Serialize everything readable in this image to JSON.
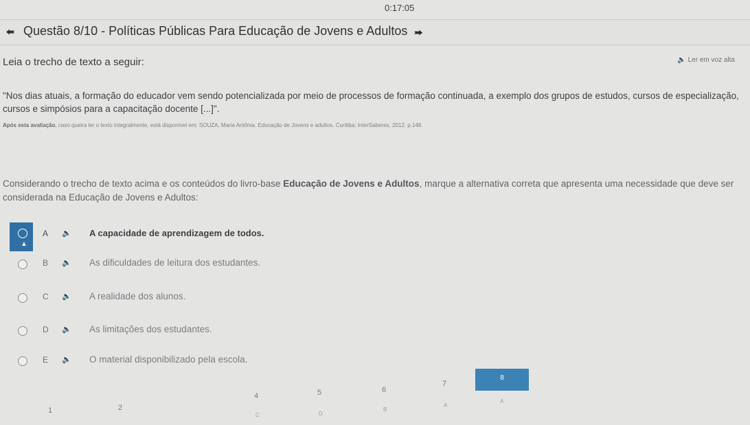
{
  "timer": "0:17:05",
  "header": {
    "prev_icon": "arrow-left-icon",
    "title": "Questão 8/10 - Políticas Públicas Para Educação de Jovens e Adultos",
    "next_icon": "arrow-right-icon"
  },
  "instruction": "Leia o trecho de texto a seguir:",
  "read_aloud": "Ler em voz alta",
  "quote": "\"Nos dias atuais, a formação do educador vem sendo potencializada por meio de processos de formação continuada, a exemplo dos grupos de estudos, cursos de especialização, cursos e simpósios para a capacitação docente [...]\".",
  "source": {
    "lead": "Após esta avaliação",
    "text": ", caso queira ler o texto integralmente, está disponível em: SOUZA, Maria Antônia. Educação de Jovens e adultos. Curitiba: InterSaberes, 2012. p.148."
  },
  "prompt": {
    "before": "Considerando o trecho de texto acima e os conteúdos do livro-base ",
    "book": "Educação de Jovens e Adultos",
    "after": ", marque a alternativa correta que apresenta uma necessidade que deve ser considerada na Educação de Jovens e Adultos:"
  },
  "options": [
    {
      "letter": "A",
      "text": "A capacidade de aprendizagem de todos.",
      "selected": true
    },
    {
      "letter": "B",
      "text": "As dificuldades de leitura dos estudantes.",
      "selected": false
    },
    {
      "letter": "C",
      "text": "A realidade dos alunos.",
      "selected": false
    },
    {
      "letter": "D",
      "text": "As limitações dos estudantes.",
      "selected": false
    },
    {
      "letter": "E",
      "text": "O material disponibilizado pela escola.",
      "selected": false
    }
  ],
  "pager": {
    "items": [
      {
        "num": "1",
        "sub": ""
      },
      {
        "num": "2",
        "sub": ""
      },
      {
        "num": "4",
        "sub": "C"
      },
      {
        "num": "5",
        "sub": "D"
      },
      {
        "num": "6",
        "sub": "B"
      },
      {
        "num": "7",
        "sub": "A"
      }
    ],
    "current": {
      "num": "8",
      "sub": "A"
    }
  }
}
